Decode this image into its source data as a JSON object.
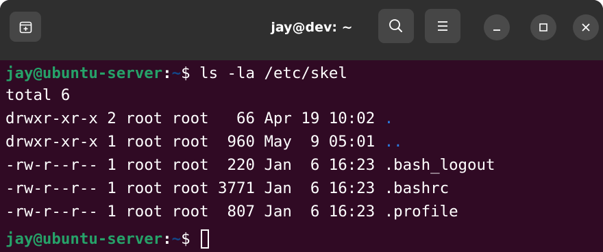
{
  "window": {
    "title": "jay@dev: ~",
    "icons": {
      "new_tab": "new-tab-icon",
      "search": "search-icon",
      "menu": "hamburger-menu-icon",
      "minimize": "minimize-icon",
      "maximize": "maximize-icon",
      "close": "close-icon"
    }
  },
  "colors": {
    "terminal_background": "#300a24",
    "titlebar_background": "#2f2f2f",
    "prompt_user": "#26a269",
    "prompt_path": "#12488b",
    "directory": "#2a7bde",
    "text": "#ffffff"
  },
  "terminal": {
    "prompt_user_host": "jay@ubuntu-server",
    "prompt_colon": ":",
    "prompt_path": "~",
    "prompt_symbol": "$ ",
    "command": "ls -la /etc/skel",
    "output": {
      "total": "total 6",
      "entries": [
        {
          "prefix": "drwxr-xr-x 2 root root   66 Apr 19 10:02 ",
          "name": "."
        },
        {
          "prefix": "drwxr-xr-x 1 root root  960 May  9 05:01 ",
          "name": ".."
        },
        {
          "prefix": "-rw-r--r-- 1 root root  220 Jan  6 16:23 ",
          "name": ".bash_logout"
        },
        {
          "prefix": "-rw-r--r-- 1 root root 3771 Jan  6 16:23 ",
          "name": ".bashrc"
        },
        {
          "prefix": "-rw-r--r-- 1 root root  807 Jan  6 16:23 ",
          "name": ".profile"
        }
      ]
    }
  }
}
